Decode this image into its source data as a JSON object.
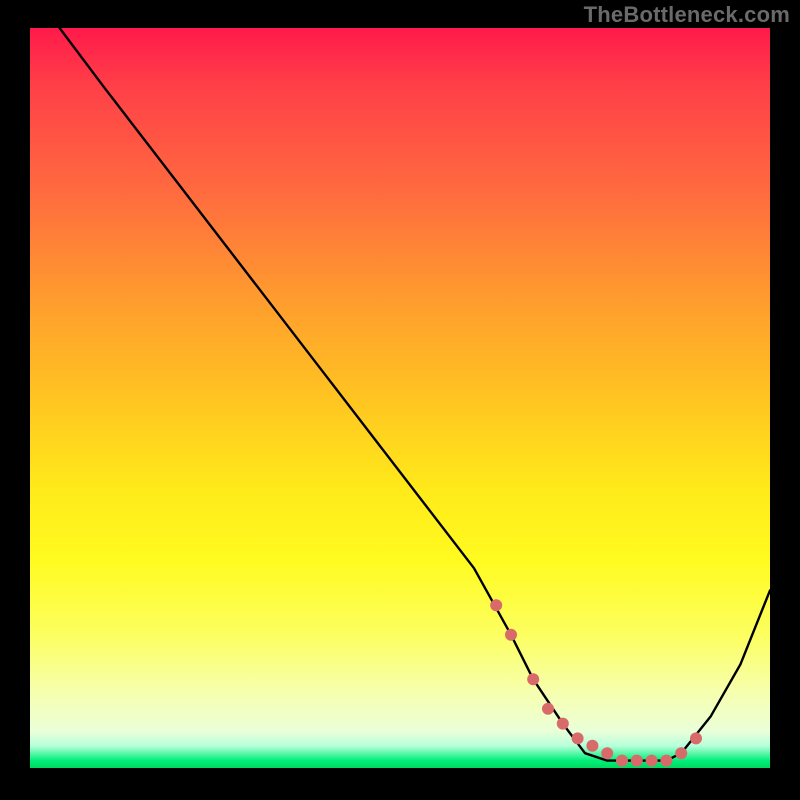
{
  "watermark": "TheBottleneck.com",
  "chart_data": {
    "type": "line",
    "title": "",
    "xlabel": "",
    "ylabel": "",
    "xlim": [
      0,
      100
    ],
    "ylim": [
      0,
      100
    ],
    "grid": false,
    "legend": false,
    "series": [
      {
        "name": "curve",
        "x": [
          4,
          10,
          20,
          30,
          40,
          50,
          60,
          65,
          68,
          72,
          75,
          78,
          81,
          84,
          86,
          88,
          92,
          96,
          100
        ],
        "values": [
          100,
          92,
          79,
          66,
          53,
          40,
          27,
          18,
          12,
          6,
          2,
          1,
          1,
          1,
          1,
          2,
          7,
          14,
          24
        ]
      }
    ],
    "markers": {
      "name": "highlight-dots",
      "color": "#d96a6a",
      "x": [
        63,
        65,
        68,
        70,
        72,
        74,
        76,
        78,
        80,
        82,
        84,
        86,
        88,
        90
      ],
      "values": [
        22,
        18,
        12,
        8,
        6,
        4,
        3,
        2,
        1,
        1,
        1,
        1,
        2,
        4
      ]
    }
  }
}
